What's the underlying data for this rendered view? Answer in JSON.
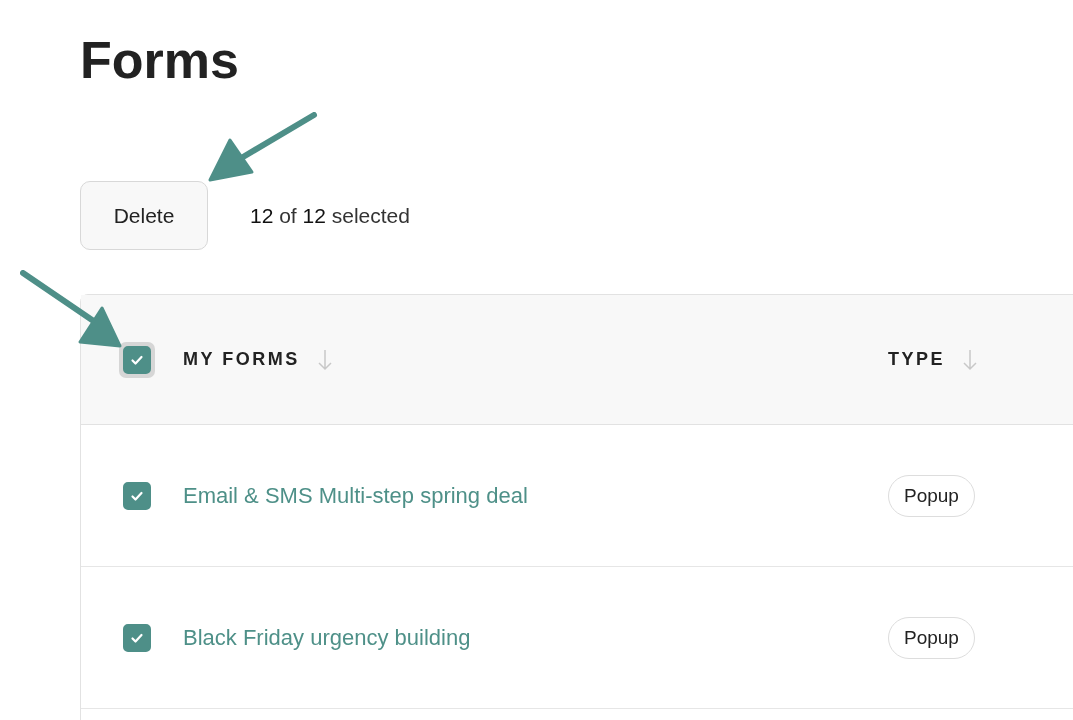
{
  "title": "Forms",
  "toolbar": {
    "delete_button": "Delete",
    "selection_text": "**12** of **12** selected"
  },
  "table": {
    "select_all": {
      "checked": true
    },
    "columns": [
      {
        "label": "MY FORMS"
      },
      {
        "label": "TYPE"
      }
    ],
    "rows": [
      {
        "name": "Email & SMS Multi-step spring deal",
        "type": "Popup",
        "checked": true
      },
      {
        "name": "Black Friday urgency building",
        "type": "Popup",
        "checked": true
      }
    ]
  }
}
